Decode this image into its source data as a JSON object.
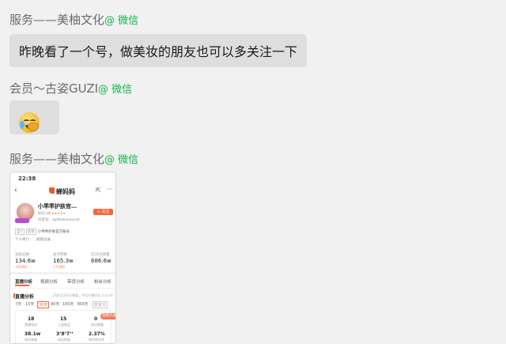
{
  "messages": [
    {
      "sender": "服务——美柚文化",
      "source": "@ 微信",
      "text": "昨晚看了一个号，做美妆的朋友也可以多关注一下"
    },
    {
      "sender": "会员～古姿GUZI",
      "source": "@ 微信",
      "emoji": "loudly-crying-face"
    },
    {
      "sender": "服务——美柚文化",
      "source": "@ 微信",
      "image": "phone-screenshot"
    }
  ],
  "phone": {
    "time": "22:38",
    "app_name": "蝉妈妈",
    "account_name": "小乖乖护肤官…",
    "account_level": "带货口碑",
    "stars": "★★★★★",
    "account_id": "抖音号：dy0kakavaunat",
    "follow_label": "+ 关注",
    "tag1": "蓝V",
    "tag2": "美妆",
    "official_line": "小乖乖护肤官方账号",
    "intro_line": "个人简介：…视频记录…",
    "stats": [
      {
        "label": "总粉丝数",
        "value": "134.6w",
        "delta": "+9,000"
      },
      {
        "label": "总点赞数",
        "value": "165.3w",
        "delta": "+7,000"
      },
      {
        "label": "近30天销量",
        "value": "686.6w",
        "delta": ""
      }
    ],
    "tabs": [
      "直播分析",
      "视频分析",
      "带货分析",
      "粉丝分析"
    ],
    "section_title": "直播分析",
    "section_note": "历史(近30天)数据，平均开播时长 2.4小时",
    "ranges": [
      "7天",
      "15天",
      "30天",
      "90天",
      "180天",
      "360天",
      "自定义"
    ],
    "metrics": [
      {
        "value": "18",
        "label": "直播场次"
      },
      {
        "value": "15",
        "label": "上架商品"
      },
      {
        "value": "0",
        "label": "场均销量"
      },
      {
        "value": "38.1w",
        "label": "场均观看"
      },
      {
        "value": "3‘8‘7‘‘",
        "label": "场均停留"
      },
      {
        "value": "2.37%",
        "label": "带货转化率"
      }
    ],
    "float_label": "直播大屏"
  }
}
